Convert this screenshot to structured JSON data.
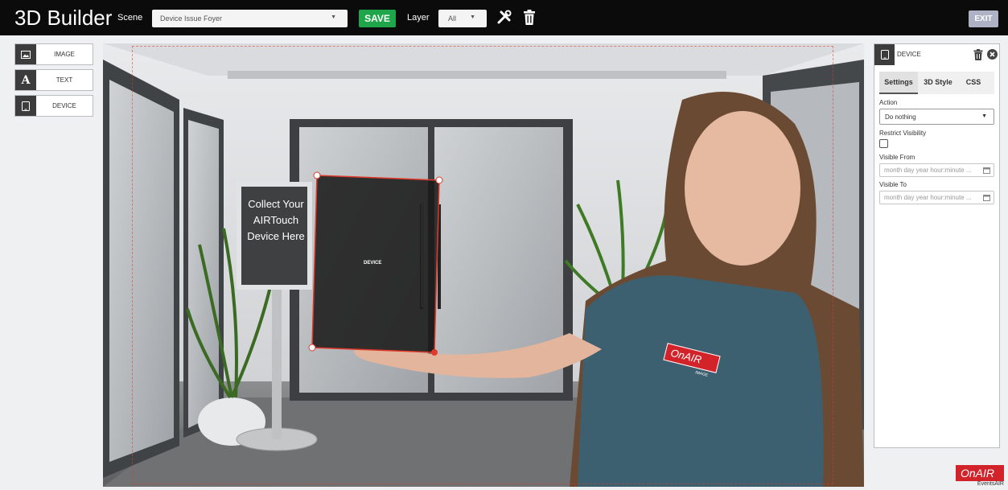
{
  "app": {
    "title": "3D Builder"
  },
  "toolbar": {
    "scene_label": "Scene",
    "scene_value": "Device Issue Foyer",
    "save_label": "SAVE",
    "layer_label": "Layer",
    "layer_value": "All",
    "exit_label": "EXIT"
  },
  "tools": [
    {
      "label": "IMAGE",
      "icon": "image-icon"
    },
    {
      "label": "TEXT",
      "icon": "text-icon",
      "glyph": "A"
    },
    {
      "label": "DEVICE",
      "icon": "device-icon"
    }
  ],
  "canvas": {
    "sign_text": [
      "Collect Your",
      "AIRTouch",
      "Device Here"
    ],
    "device_label": "DEVICE",
    "badge_text": "OnAIR",
    "badge_sub": "IMAGE"
  },
  "panel": {
    "title": "DEVICE",
    "tabs": [
      "Settings",
      "3D Style",
      "CSS"
    ],
    "action_label": "Action",
    "action_value": "Do nothing",
    "restrict_label": "Restrict Visibility",
    "visible_from_label": "Visible From",
    "visible_from_placeholder": "month day year hour:minute ...",
    "visible_to_label": "Visible To",
    "visible_to_placeholder": "month day year hour:minute ..."
  },
  "brand": {
    "logo": "OnAIR",
    "sub": "EventsAIR"
  },
  "colors": {
    "save": "#1fa54a",
    "exit": "#aeb2c4",
    "selection": "#e03a2a",
    "brand_red": "#d2232a"
  }
}
